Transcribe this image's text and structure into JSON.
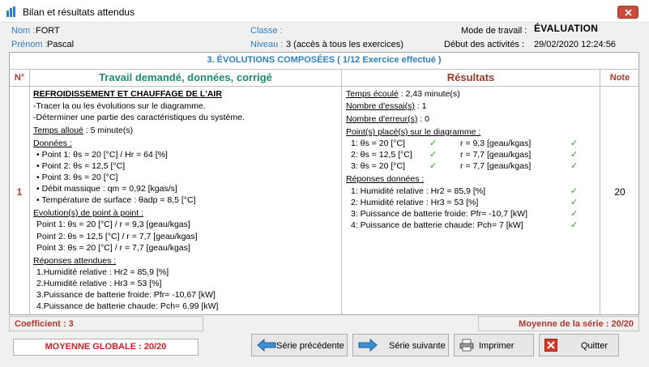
{
  "window": {
    "title": "Bilan et résultats attendus"
  },
  "header": {
    "nom_label": "Nom :",
    "nom_value": "FORT",
    "prenom_label": "Prénom :",
    "prenom_value": "Pascal",
    "classe_label": "Classe :",
    "classe_value": "",
    "niveau_label": "Niveau :",
    "niveau_value": "3  (accès à tous les exercices)",
    "mode_label": "Mode de travail :",
    "mode_value": "ÉVALUATION",
    "debut_label": "Début des activités :",
    "debut_value": "29/02/2020 12:24:56"
  },
  "panel": {
    "section_title": "3. ÉVOLUTIONS COMPOSÉES  ( 1/12 Exercice effectué )",
    "columns": {
      "n": "N°",
      "travail": "Travail demandé, données, corrigé",
      "resultats": "Résultats",
      "note": "Note"
    },
    "row_number": "1",
    "note": "20"
  },
  "travail": {
    "title": "REFROIDISSEMENT ET CHAUFFAGE DE L'AIR",
    "consignes": [
      "-Tracer la ou les évolutions sur le diagramme.",
      "-Déterminer une partie des caractéristiques du système."
    ],
    "temps_label": "Temps alloué",
    "temps_value": " : 5 minute(s)",
    "donnees_label": "Données :",
    "donnees": [
      "• Point 1: θs = 20 [°C] / Hr = 64 [%]",
      "• Point 2: θs = 12,5 [°C]",
      "• Point 3: θs = 20 [°C]",
      "• Débit massique : qm = 0,92 [kgas/s]",
      "• Température de surface : θadp = 8,5 [°C]"
    ],
    "evolution_label": "Evolution(s) de point à point :",
    "evolution": [
      "Point 1: θs = 20 [°C] / r = 9,3 [geau/kgas]",
      "Point 2: θs = 12,5 [°C] / r = 7,7 [geau/kgas]",
      "Point 3: θs = 20 [°C] / r = 7,7 [geau/kgas]"
    ],
    "reponses_label": "Réponses attendues :",
    "reponses": [
      "1.Humidité relative : Hr2 = 85,9 [%]",
      "2.Humidité relative : Hr3 = 53 [%]",
      "3.Puissance de batterie froide: Pfr= -10,67 [kW]",
      "4.Puissance de batterie chaude: Pch= 6.99 [kW]"
    ]
  },
  "resultats": {
    "temps_label": "Temps écoulé",
    "temps_value": " : 2,43 minute(s)",
    "essais_label": "Nombre d'essai(s)",
    "essais_value": " :  1",
    "erreurs_label": "Nombre d'erreur(s)",
    "erreurs_value": " :  0",
    "points_label": "Point(s) placé(s) sur le diagramme :",
    "points": [
      {
        "point": "1: θs = 20 [°C]",
        "r": "r = 9,3 [geau/kgas]"
      },
      {
        "point": "2: θs = 12,5 [°C]",
        "r": "r = 7,7 [geau/kgas]"
      },
      {
        "point": "3: θs = 20 [°C]",
        "r": "r = 7,7 [geau/kgas]"
      }
    ],
    "reponses_label": "Réponses données :",
    "reponses": [
      "1: Humidité relative : Hr2 = 85,9 [%]",
      "2: Humidité relative : Hr3 = 53 [%]",
      "3: Puissance de batterie froide: Pfr= -10,7 [kW]",
      "4: Puissance de batterie chaude: Pch= 7 [kW]"
    ],
    "check": "✓"
  },
  "footer": {
    "coefficient": "Coefficient : 3",
    "moyenne_serie": "Moyenne de la série : 20/20",
    "moyenne_globale": "MOYENNE GLOBALE : 20/20"
  },
  "buttons": {
    "precedente": "Série précédente",
    "suivante": "Série suivante",
    "imprimer": "Imprimer",
    "quitter": "Quitter"
  },
  "colors": {
    "accent_blue": "#2f7fc1",
    "red": "#c0392b",
    "teal": "#1f8a78",
    "check_green": "#2aa02a",
    "close_red": "#c94b3c"
  },
  "icons": [
    "app-chart-icon",
    "close-icon",
    "arrow-left-icon",
    "arrow-right-icon",
    "printer-icon",
    "quit-icon"
  ]
}
